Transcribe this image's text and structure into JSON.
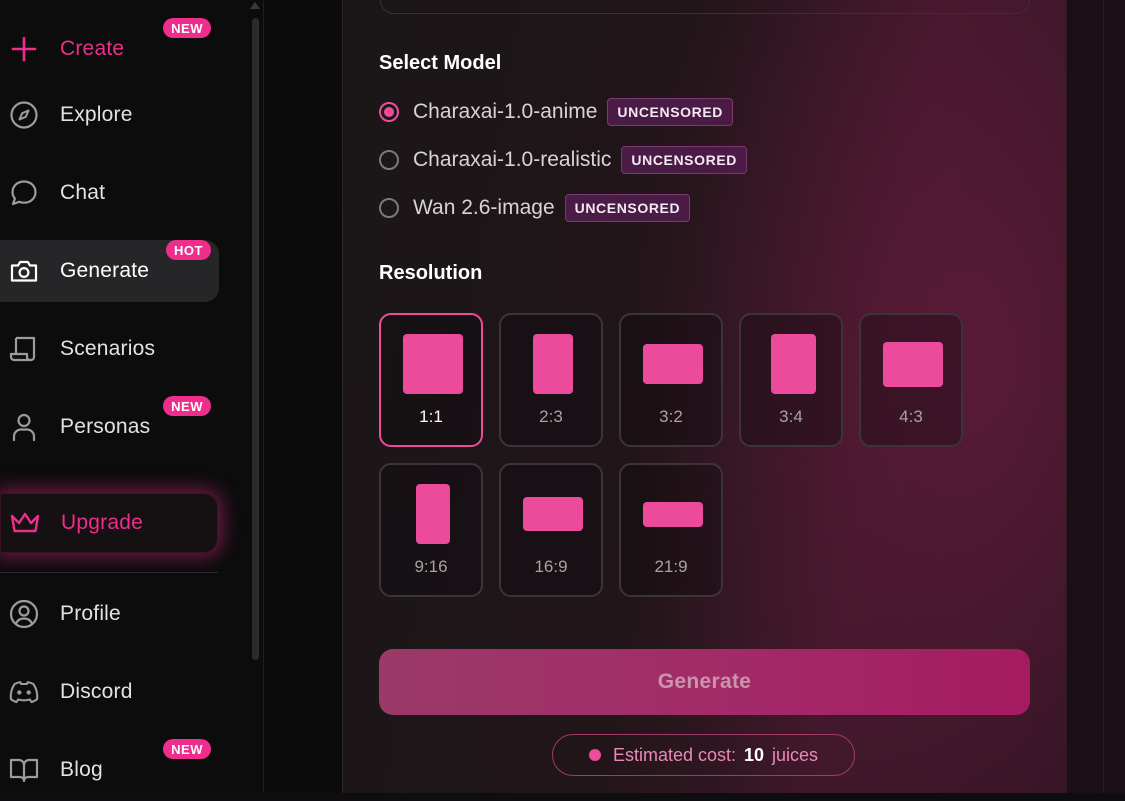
{
  "sidebar": {
    "items": [
      {
        "label": "Create",
        "icon": "plus-icon",
        "badge": "NEW"
      },
      {
        "label": "Explore",
        "icon": "compass-icon"
      },
      {
        "label": "Chat",
        "icon": "chat-bubble-icon"
      },
      {
        "label": "Generate",
        "icon": "camera-icon",
        "badge": "HOT"
      },
      {
        "label": "Scenarios",
        "icon": "scroll-icon"
      },
      {
        "label": "Personas",
        "icon": "person-icon",
        "badge": "NEW"
      },
      {
        "label": "Upgrade",
        "icon": "crown-icon"
      },
      {
        "label": "Profile",
        "icon": "user-circle-icon"
      },
      {
        "label": "Discord",
        "icon": "discord-icon"
      },
      {
        "label": "Blog",
        "icon": "book-icon",
        "badge": "NEW"
      }
    ],
    "active": "Generate"
  },
  "main": {
    "model_title": "Select Model",
    "models": [
      {
        "name": "Charaxai-1.0-anime",
        "tag": "UNCENSORED",
        "selected": true
      },
      {
        "name": "Charaxai-1.0-realistic",
        "tag": "UNCENSORED",
        "selected": false
      },
      {
        "name": "Wan 2.6-image",
        "tag": "UNCENSORED",
        "selected": false
      }
    ],
    "resolution_title": "Resolution",
    "resolutions": [
      "1:1",
      "2:3",
      "3:2",
      "3:4",
      "4:3",
      "9:16",
      "16:9",
      "21:9"
    ],
    "selected_resolution": "1:1",
    "generate_label": "Generate",
    "cost": {
      "label": "Estimated cost:",
      "value": "10",
      "unit": "juices"
    }
  },
  "colors": {
    "accent": "#ee2d8c",
    "tile_fill": "#ec4b9b"
  }
}
